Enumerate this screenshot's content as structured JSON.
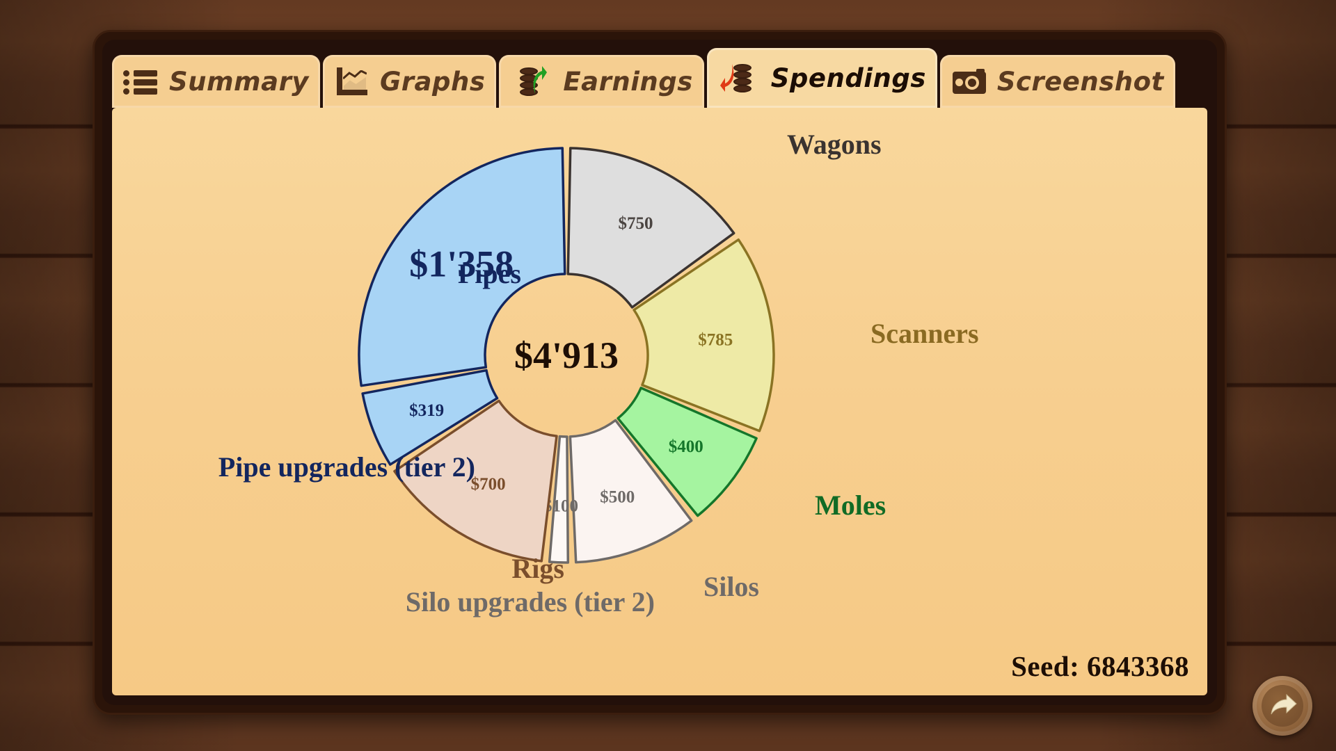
{
  "window": {
    "title": "Spendings"
  },
  "tabs": [
    {
      "id": "summary",
      "label": "Summary",
      "icon": "list-icon",
      "active": false
    },
    {
      "id": "graphs",
      "label": "Graphs",
      "icon": "line-chart-icon",
      "active": false
    },
    {
      "id": "earnings",
      "label": "Earnings",
      "icon": "coins-up-icon",
      "active": false
    },
    {
      "id": "spendings",
      "label": "Spendings",
      "icon": "coins-down-icon",
      "active": true
    },
    {
      "id": "screenshot",
      "label": "Screenshot",
      "icon": "camera-icon",
      "active": false
    }
  ],
  "footer": {
    "seed_label": "Seed: 6843368",
    "back_button_label": "Back"
  },
  "chart_data": {
    "type": "pie",
    "variant": "donut",
    "title": "Spendings",
    "center_label": "$4'913",
    "total": 4913,
    "currency_prefix": "$",
    "thousands_separator": "'",
    "start_angle_deg": 0,
    "direction": "clockwise",
    "legend": "labels-outside",
    "categories": [
      "Wagons",
      "Scanners",
      "Moles",
      "Silos",
      "Silo upgrades (tier 2)",
      "Rigs",
      "Pipe upgrades (tier 2)",
      "Pipes"
    ],
    "values": [
      750,
      785,
      400,
      500,
      100,
      700,
      319,
      1358
    ],
    "value_labels": [
      "$750",
      "$785",
      "$400",
      "$500",
      "$100",
      "$700",
      "$319",
      "$1'358"
    ],
    "slices": [
      {
        "name": "Wagons",
        "value": 750,
        "value_label": "$750",
        "fill": "#dedede",
        "stroke": "#3a3330",
        "text": "#4a4441",
        "label_text": "#3a3330",
        "label_side": "right"
      },
      {
        "name": "Scanners",
        "value": 785,
        "value_label": "$785",
        "fill": "#eeeaa6",
        "stroke": "#8a7323",
        "text": "#8a7323",
        "label_text": "#8a6a22",
        "label_side": "right"
      },
      {
        "name": "Moles",
        "value": 400,
        "value_label": "$400",
        "fill": "#a5f4a0",
        "stroke": "#14762a",
        "text": "#14762a",
        "label_text": "#116b25",
        "label_side": "right"
      },
      {
        "name": "Silos",
        "value": 500,
        "value_label": "$500",
        "fill": "#fbf4f1",
        "stroke": "#6e6a68",
        "text": "#6e6a68",
        "label_text": "#6e6a68",
        "label_side": "right"
      },
      {
        "name": "Silo upgrades (tier 2)",
        "value": 100,
        "value_label": "$100",
        "fill": "#fdf8f5",
        "stroke": "#6e6a68",
        "text": "#6e6a68",
        "label_text": "#6e6a68",
        "label_side": "bottom"
      },
      {
        "name": "Rigs",
        "value": 700,
        "value_label": "$700",
        "fill": "#eed5c5",
        "stroke": "#7a4e2c",
        "text": "#7a4e2c",
        "label_text": "#7a4e2c",
        "label_side": "bottom"
      },
      {
        "name": "Pipe upgrades (tier 2)",
        "value": 319,
        "value_label": "$319",
        "fill": "#a8d4f5",
        "stroke": "#13265e",
        "text": "#13265e",
        "label_text": "#13265e",
        "label_side": "left"
      },
      {
        "name": "Pipes",
        "value": 1358,
        "value_label": "$1'358",
        "fill": "#a8d4f5",
        "stroke": "#13265e",
        "text": "#13265e",
        "label_text": "#13265e",
        "label_side": "left"
      }
    ]
  },
  "colors": {
    "window_frame": "#2b1409",
    "panel_bg": "#f7cf90",
    "tab_bg": "#f5ce91",
    "tab_active_bg": "#f7d9a2",
    "tab_text": "#5b3b20",
    "tab_active_text": "#1b0d05",
    "wood": "#643a22",
    "accent_green": "#21a024",
    "accent_red": "#e03a16"
  }
}
